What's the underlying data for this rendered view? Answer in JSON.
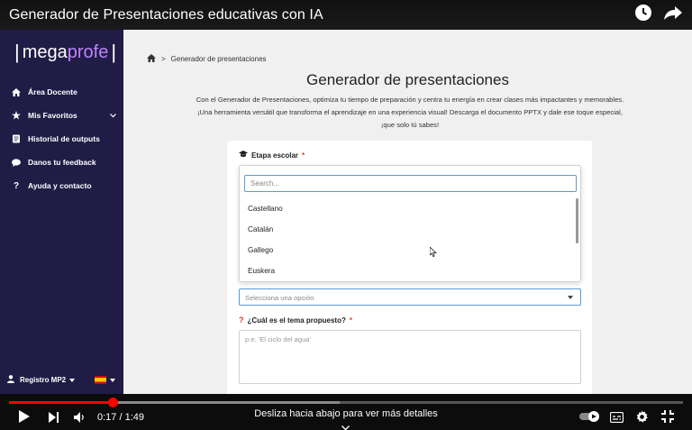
{
  "video": {
    "title": "Generador de Presentaciones educativas con IA",
    "time": "0:17 / 1:49",
    "progress_fraction": 0.155,
    "buffer_fraction": 0.49,
    "hint": "Desliza hacia abajo para ver más detalles"
  },
  "logo": {
    "left_bar": "|",
    "mega": "mega",
    "profe": "profe",
    "right_bar": "|"
  },
  "sidebar": {
    "items": [
      {
        "label": "Área Docente",
        "icon": "home-icon"
      },
      {
        "label": "Mis Favoritos",
        "icon": "star-icon"
      },
      {
        "label": "Historial de outputs",
        "icon": "history-icon"
      },
      {
        "label": "Danos tu feedback",
        "icon": "chat-icon"
      },
      {
        "label": "Ayuda y contacto",
        "icon": "help-icon"
      }
    ],
    "user": "Registro MP2"
  },
  "breadcrumb": {
    "separator": ">",
    "current": "Generador de presentaciones"
  },
  "page": {
    "title": "Generador de presentaciones",
    "description": "Con el Generador de Presentaciones, optimiza tu tiempo de preparación y centra tu energía en crear clases más impactantes y memorables. ¡Una herramienta versátil que transforma el aprendizaje en una experiencia visual! Descarga el documento PPTX y dale ese toque especial, ¡que solo tú sabes!"
  },
  "form": {
    "stage_label": "Etapa escolar",
    "required_mark": "*",
    "search_placeholder": "Search...",
    "options": [
      "Castellano",
      "Catalán",
      "Gallego",
      "Euskera"
    ],
    "select_placeholder": "Selecciona una opción",
    "topic_label": "¿Cuál es el tema propuesto?",
    "topic_placeholder": "p.e. 'El ciclo del agua'"
  },
  "colors": {
    "sidebar": "#201c46",
    "accent": "#c084fc",
    "progress": "#ff0000"
  }
}
